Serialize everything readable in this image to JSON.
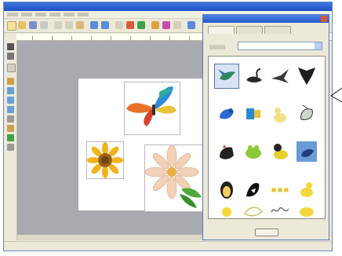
{
  "app": {
    "title": ""
  },
  "dialog": {
    "title": "",
    "ok_label": "",
    "category_label": "",
    "category_value": ""
  },
  "colors": {
    "title_bar": "#2a5fd0",
    "workspace": "#a9aab0",
    "selection": "#d8e4f6"
  },
  "canvas_objects": [
    "butterfly",
    "sunflower",
    "flower-spray"
  ],
  "motifs": [
    {
      "icon": "hummingbird-icon",
      "selected": true
    },
    {
      "icon": "swan-icon",
      "selected": false
    },
    {
      "icon": "flying-bird-icon",
      "selected": false
    },
    {
      "icon": "eagle-icon",
      "selected": false
    },
    {
      "icon": "bluebird-icon",
      "selected": false
    },
    {
      "icon": "parrot-icon",
      "selected": false
    },
    {
      "icon": "duckling-icon",
      "selected": false
    },
    {
      "icon": "cockatoo-icon",
      "selected": false
    },
    {
      "icon": "rooster-icon",
      "selected": false
    },
    {
      "icon": "frog-icon",
      "selected": false
    },
    {
      "icon": "duck-icon",
      "selected": false
    },
    {
      "icon": "blue-bird-square-icon",
      "selected": false
    },
    {
      "icon": "penguin-icon",
      "selected": false
    },
    {
      "icon": "magpie-icon",
      "selected": false
    },
    {
      "icon": "ducklings-row-icon",
      "selected": false
    },
    {
      "icon": "chick-icon",
      "selected": false
    },
    {
      "icon": "chick-small-icon",
      "selected": false
    },
    {
      "icon": "swan-outline-icon",
      "selected": false
    },
    {
      "icon": "script-text-icon",
      "selected": false
    },
    {
      "icon": "chick-sitting-icon",
      "selected": false
    }
  ]
}
